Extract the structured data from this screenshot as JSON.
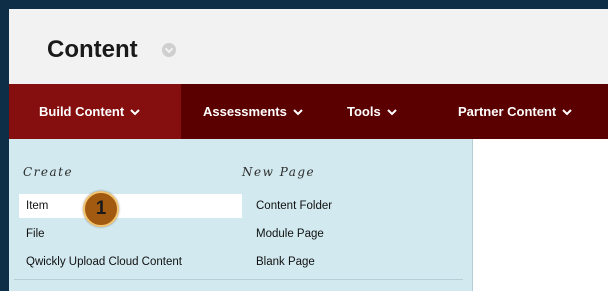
{
  "header": {
    "title": "Content"
  },
  "menu": [
    {
      "label": "Build Content",
      "active": true
    },
    {
      "label": "Assessments",
      "active": false
    },
    {
      "label": "Tools",
      "active": false
    },
    {
      "label": "Partner Content",
      "active": false
    }
  ],
  "dropdown": {
    "create": {
      "heading": "Create",
      "items": [
        "Item",
        "File",
        "Qwickly Upload Cloud Content"
      ]
    },
    "new_page": {
      "heading": "New Page",
      "items": [
        "Content Folder",
        "Module Page",
        "Blank Page"
      ]
    }
  },
  "marker": {
    "label": "1"
  },
  "icons": {
    "title_options": "chevron-down-circle-icon",
    "menu_chevron": "chevron-down-icon"
  },
  "colors": {
    "frame": "#0e2d46",
    "menubar": "#5b0000",
    "menubar_active": "#850e0e",
    "dropdown": "#d1e9ef",
    "marker": "#a15a10"
  }
}
